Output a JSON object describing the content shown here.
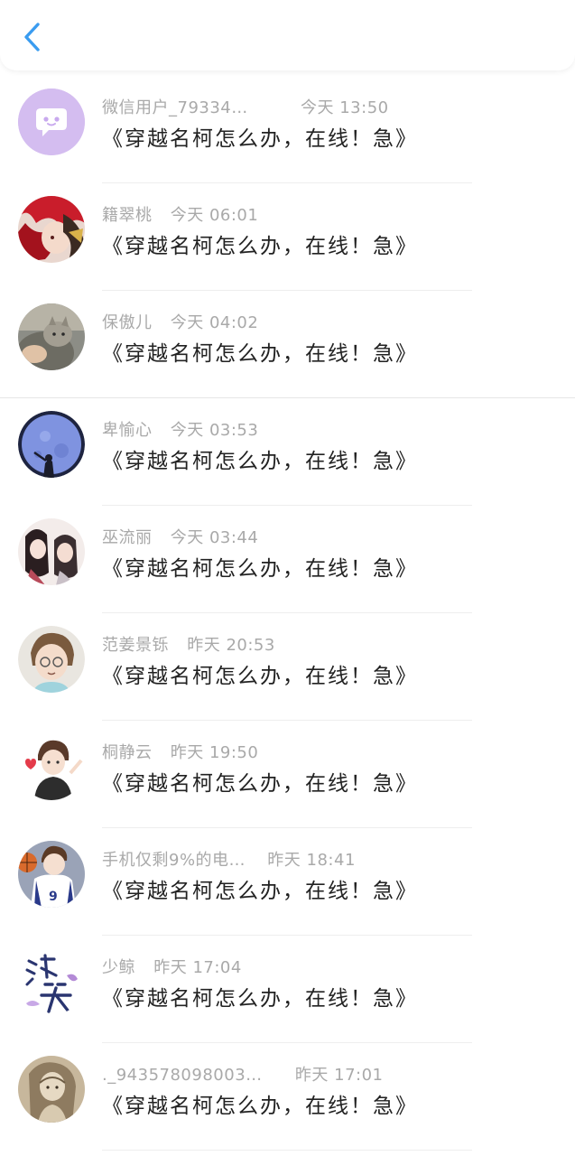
{
  "header": {
    "back_icon": "chevron-left-icon",
    "accent": "#3a9cf0"
  },
  "message": "《穿越名柯怎么办，在线！急》",
  "items": [
    {
      "name": "微信用户_79334…",
      "time": "今天 13:50",
      "avatar": "wechat-default-avatar"
    },
    {
      "name": "籍翠桃",
      "time": "今天 06:01",
      "avatar": "anime-redhair-avatar"
    },
    {
      "name": "保傲儿",
      "time": "今天 04:02",
      "avatar": "cat-photo-avatar"
    },
    {
      "name": "卑愉心",
      "time": "今天 03:53",
      "avatar": "moon-night-avatar"
    },
    {
      "name": "巫流丽",
      "time": "今天 03:44",
      "avatar": "ancient-couple-avatar"
    },
    {
      "name": "范姜景铄",
      "time": "昨天 20:53",
      "avatar": "cartoon-boy-glasses-avatar"
    },
    {
      "name": "桐静云",
      "time": "昨天 19:50",
      "avatar": "cartoon-boy-heart-avatar"
    },
    {
      "name": "手机仅剩9%的电…",
      "time": "昨天 18:41",
      "avatar": "basketball-boy-avatar"
    },
    {
      "name": "少鲸",
      "time": "昨天 17:04",
      "avatar": "calligraphy-text-avatar"
    },
    {
      "name": "._943578098003…",
      "time": "昨天 17:01",
      "avatar": "sketch-girl-avatar"
    }
  ]
}
